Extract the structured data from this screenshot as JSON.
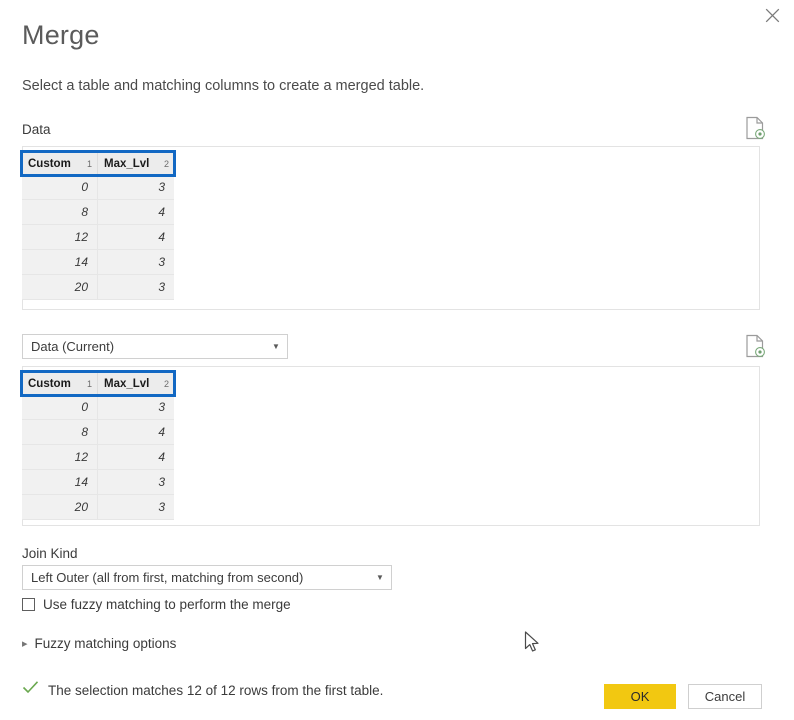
{
  "dialog": {
    "title": "Merge",
    "subtitle": "Select a table and matching columns to create a merged table.",
    "close_icon": "close-icon"
  },
  "first_table": {
    "label": "Data",
    "preview_icon": "table-preview-icon",
    "columns": [
      {
        "name": "Custom",
        "order": "1"
      },
      {
        "name": "Max_Lvl",
        "order": "2"
      }
    ],
    "rows": [
      [
        "0",
        "3"
      ],
      [
        "8",
        "4"
      ],
      [
        "12",
        "4"
      ],
      [
        "14",
        "3"
      ],
      [
        "20",
        "3"
      ]
    ]
  },
  "second_table": {
    "selected": "Data (Current)",
    "preview_icon": "table-preview-icon",
    "columns": [
      {
        "name": "Custom",
        "order": "1"
      },
      {
        "name": "Max_Lvl",
        "order": "2"
      }
    ],
    "rows": [
      [
        "0",
        "3"
      ],
      [
        "8",
        "4"
      ],
      [
        "12",
        "4"
      ],
      [
        "14",
        "3"
      ],
      [
        "20",
        "3"
      ]
    ]
  },
  "join": {
    "label": "Join Kind",
    "selected": "Left Outer (all from first, matching from second)"
  },
  "fuzzy": {
    "checkbox_label": "Use fuzzy matching to perform the merge",
    "checked": false,
    "options_label": "Fuzzy matching options",
    "options_expanded": false
  },
  "status": {
    "text": "The selection matches 12 of 12 rows from the first table.",
    "icon": "checkmark-icon",
    "icon_color": "#6aa84f"
  },
  "footer": {
    "ok_label": "OK",
    "cancel_label": "Cancel",
    "ok_color": "#f2c811"
  },
  "colors": {
    "selection_blue": "#1268c3",
    "grid_header_bg": "#ececec",
    "grid_row_bg": "#f1f1f1"
  }
}
